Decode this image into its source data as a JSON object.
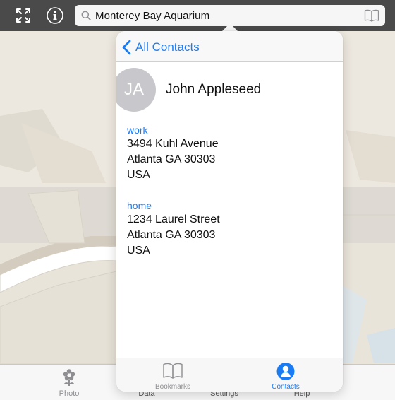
{
  "toolbar": {
    "expand_icon": "expand-arrows-icon",
    "info_icon": "info-circle-icon"
  },
  "search": {
    "value": "Monterey Bay Aquarium",
    "search_icon": "magnifier-icon",
    "bookmarks_icon": "open-book-icon"
  },
  "popover": {
    "back_label": "All Contacts",
    "contact": {
      "initials": "JA",
      "name": "John Appleseed"
    },
    "addresses": [
      {
        "label": "work",
        "street": "3494 Kuhl Avenue",
        "city": "Atlanta GA 30303",
        "country": "USA"
      },
      {
        "label": "home",
        "street": "1234 Laurel Street",
        "city": "Atlanta GA 30303",
        "country": "USA"
      }
    ],
    "tabs": [
      {
        "label": "Bookmarks",
        "icon": "open-book-icon",
        "selected": false
      },
      {
        "label": "Contacts",
        "icon": "person-circle-icon",
        "selected": true
      }
    ]
  },
  "background_tabs": [
    {
      "label": "Photo",
      "icon": "flower-icon"
    },
    {
      "label": "Data"
    },
    {
      "label": "Settings"
    },
    {
      "label": "Help"
    }
  ],
  "colors": {
    "accent": "#1a7cf5",
    "toolbar": "#4a4a4a",
    "map_land": "#e9e4da",
    "avatar": "#c7c7cc"
  }
}
